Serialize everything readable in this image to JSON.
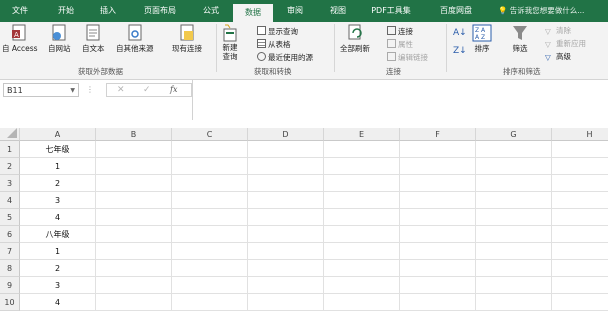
{
  "menu": {
    "tabs": [
      "文件",
      "开始",
      "插入",
      "页面布局",
      "公式",
      "数据",
      "审阅",
      "视图",
      "PDF工具集",
      "百度网盘"
    ],
    "active": "数据",
    "tell_me": "告诉我您想要做什么..."
  },
  "ribbon": {
    "get_external": {
      "buttons": [
        "自 Access",
        "自网站",
        "自文本",
        "自其他来源",
        "现有连接"
      ],
      "label": "获取外部数据"
    },
    "transform": {
      "new_query": "新建\n查询",
      "items": [
        "显示查询",
        "从表格",
        "最近使用的源"
      ],
      "label": "获取和转换"
    },
    "connections": {
      "refresh_all": "全部刷新",
      "items": [
        "连接",
        "属性",
        "编辑链接"
      ],
      "label": "连接"
    },
    "sort_filter": {
      "sort": "排序",
      "filter": "筛选",
      "items": [
        "清除",
        "重新应用",
        "高级"
      ],
      "label": "排序和筛选"
    }
  },
  "formula_bar": {
    "name_box": "B11",
    "fx": "fx"
  },
  "sheet": {
    "columns": [
      "A",
      "B",
      "C",
      "D",
      "E",
      "F",
      "G",
      "H"
    ],
    "rows": [
      {
        "num": "1",
        "a": "七年级"
      },
      {
        "num": "2",
        "a": "1"
      },
      {
        "num": "3",
        "a": "2"
      },
      {
        "num": "4",
        "a": "3"
      },
      {
        "num": "5",
        "a": "4"
      },
      {
        "num": "6",
        "a": "八年级"
      },
      {
        "num": "7",
        "a": "1"
      },
      {
        "num": "8",
        "a": "2"
      },
      {
        "num": "9",
        "a": "3"
      },
      {
        "num": "10",
        "a": "4"
      }
    ]
  },
  "colors": {
    "accent": "#217346",
    "ribbon_bg": "#f3f3f3"
  }
}
